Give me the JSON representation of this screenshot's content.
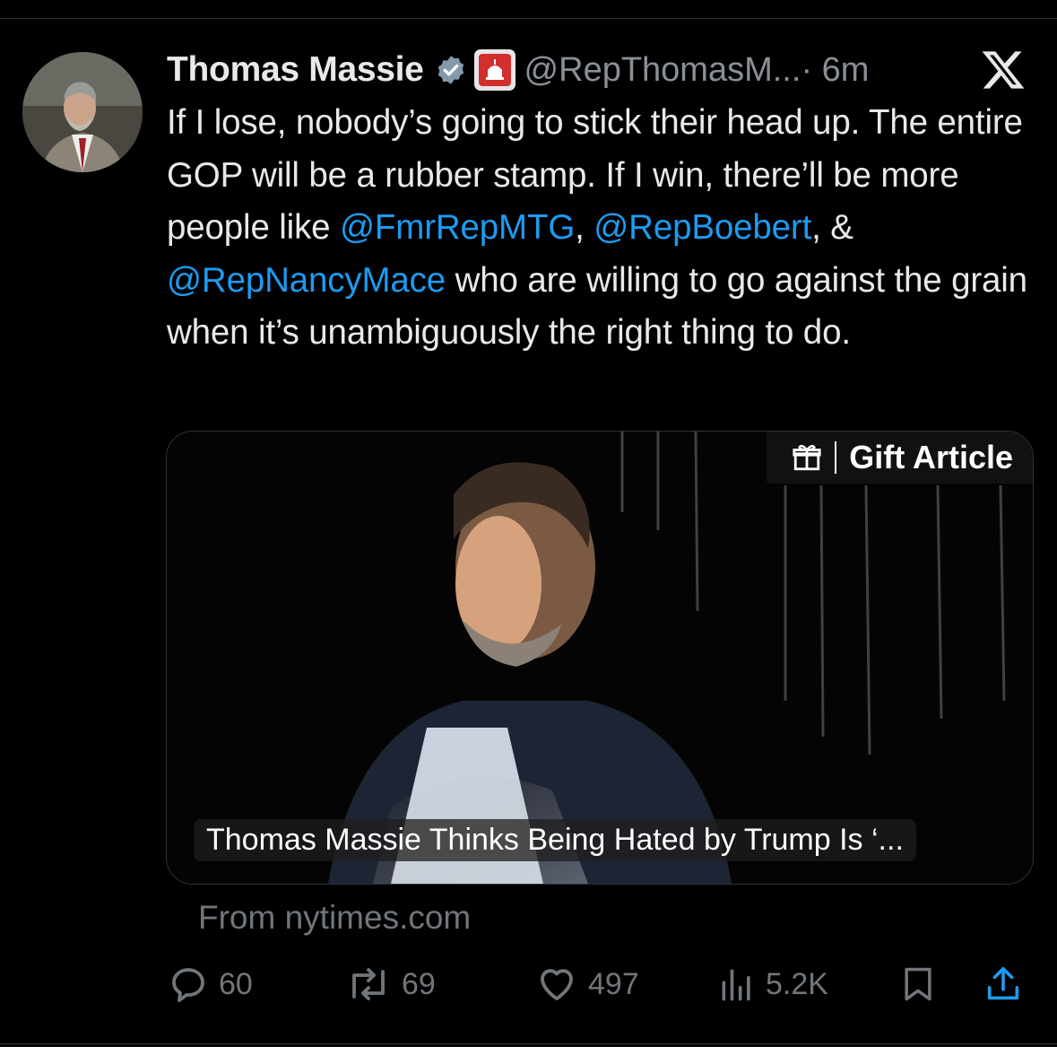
{
  "tweet": {
    "author_name": "Thomas Massie",
    "handle": "@RepThomasM...",
    "time": "· 6m",
    "verified_color": "#829aab",
    "text_parts": {
      "p1": "If I lose, nobody’s going to stick their head up. The entire GOP will be a rubber stamp. If I win, there’ll be more people like ",
      "m1": "@FmrRepMTG",
      "p2": ", ",
      "m2": "@RepBoebert",
      "p3": ", & ",
      "m3": "@RepNancyMace",
      "p4": " who are willing to go against the grain when it’s unambiguously the right thing to do."
    }
  },
  "card": {
    "gift_label": "Gift Article",
    "caption": "Thomas Massie Thinks Being Hated by Trump Is ‘...",
    "source": "From nytimes.com"
  },
  "actions": {
    "replies": "60",
    "reposts": "69",
    "likes": "497",
    "views": "5.2K"
  },
  "icons": [
    "verified-badge-icon",
    "gop-affiliation-icon",
    "x-logo-icon",
    "gift-icon",
    "reply-icon",
    "repost-icon",
    "like-icon",
    "views-icon",
    "bookmark-icon",
    "share-icon"
  ]
}
